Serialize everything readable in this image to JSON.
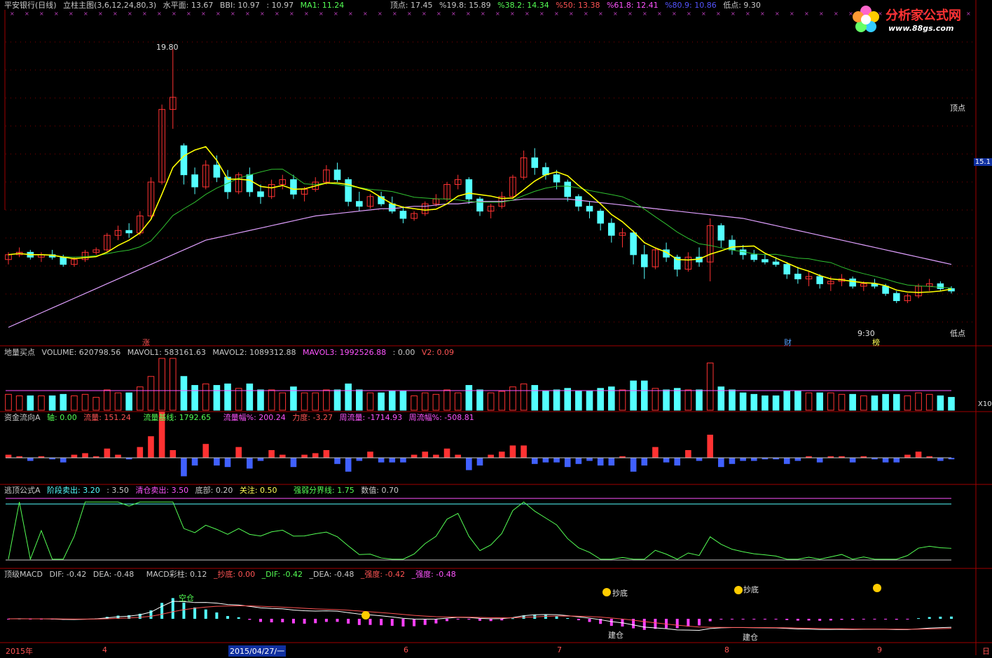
{
  "header": {
    "title": "平安银行(日线)",
    "indicator": "立柱主图(3,6,12,24,80,3)",
    "shuipingmian": "水平面: 13.67",
    "bbi": "BBI: 10.97",
    "extra": ": 10.97",
    "ma1": "MA1: 11.24",
    "top": "顶点: 17.45",
    "p19": "%19.8: 15.89",
    "p38": "%38.2: 14.34",
    "p50": "%50: 13.38",
    "p61": "%61.8: 12.41",
    "p80": "%80.9: 10.86",
    "low": "低点: 9.30"
  },
  "logo": {
    "title": "分析家公式网",
    "url": "www.88gs.com"
  },
  "main_annotations": {
    "high_label": "19.80",
    "low_label": "9:30",
    "top_right": "顶点",
    "bottom_right": "低点",
    "price_box": "15.1",
    "zhang": "涨",
    "cai": "财",
    "bang": "榜"
  },
  "volume_header": {
    "name": "地量买点",
    "volume": "VOLUME: 620798.56",
    "mavol1": "MAVOL1: 583161.63",
    "mavol2": "MAVOL2: 1089312.88",
    "mavol3": "MAVOL3: 1992526.88",
    "v1": ": 0.00",
    "v2": "V2: 0.09",
    "axis_unit": "X10"
  },
  "flow_header": {
    "name": "资金流向A",
    "axis": "轴: 0.00",
    "liuliang": "流量: 151.24",
    "jixian": "流量基线: 1792.65",
    "fu": "流量幅%: 200.24",
    "lidu": "力度: -3.27",
    "zhou": "周流量: -1714.93",
    "zhoufu": "周流幅%: -508.81"
  },
  "escape_header": {
    "name": "逃顶公式A",
    "jieduan": "阶段卖出: 3.20",
    "v350": ": 3.50",
    "qingcang": "清仓卖出: 3.50",
    "dibu": "底部: 0.20",
    "guanzhu": "关注: 0.50",
    "qiangruo": "强弱分界线: 1.75",
    "shuzhi": "数值: 0.70"
  },
  "macd_header": {
    "name": "顶级MACD",
    "dif": "DIF: -0.42",
    "dea": "DEA: -0.48",
    "bar": "MACD彩柱: 0.12",
    "chaodi": "_抄底: 0.00",
    "dif2": "_DIF: -0.42",
    "dea2": "_DEA: -0.48",
    "qiang": "_强度: -0.42",
    "ruo": "_强度: -0.48"
  },
  "macd_labels": {
    "chaodi": "抄底",
    "jiancang": "建仓",
    "jiancang2": "建仓",
    "chaodi2": "抄底",
    "kongcang": "空仓"
  },
  "date_axis": {
    "year": "2015年",
    "m4": "4",
    "sel": "2015/04/27/一",
    "m6": "6",
    "m7": "7",
    "m8": "8",
    "m9": "9",
    "end": "日"
  },
  "colors": {
    "up": "#ff3232",
    "down": "#54ffff",
    "yellow": "#ffff00",
    "blue": "#0000ff",
    "green": "#00ff00",
    "grid": "#880000"
  },
  "chart_data": {
    "type": "candlestick",
    "candles": [
      [
        11.1,
        11.4,
        10.9,
        11.3
      ],
      [
        11.3,
        11.6,
        11.2,
        11.4
      ],
      [
        11.4,
        11.5,
        11.1,
        11.2
      ],
      [
        11.2,
        11.4,
        11.0,
        11.3
      ],
      [
        11.3,
        11.5,
        11.1,
        11.2
      ],
      [
        11.2,
        11.3,
        10.8,
        10.9
      ],
      [
        10.9,
        11.2,
        10.8,
        11.1
      ],
      [
        11.1,
        11.5,
        11.0,
        11.4
      ],
      [
        11.4,
        11.6,
        11.3,
        11.5
      ],
      [
        11.5,
        12.2,
        11.4,
        12.1
      ],
      [
        12.1,
        12.5,
        11.9,
        12.3
      ],
      [
        12.3,
        12.6,
        12.0,
        12.2
      ],
      [
        12.2,
        13.1,
        12.1,
        12.9
      ],
      [
        12.9,
        14.5,
        12.8,
        14.3
      ],
      [
        14.3,
        17.5,
        14.2,
        17.3
      ],
      [
        17.3,
        19.8,
        16.5,
        17.8
      ],
      [
        15.8,
        15.9,
        14.2,
        14.6
      ],
      [
        14.6,
        14.9,
        13.8,
        14.1
      ],
      [
        14.1,
        15.2,
        14.0,
        15.0
      ],
      [
        15.0,
        15.4,
        14.3,
        14.5
      ],
      [
        14.5,
        14.8,
        13.6,
        13.9
      ],
      [
        13.9,
        14.7,
        13.8,
        14.6
      ],
      [
        14.6,
        14.9,
        13.7,
        13.9
      ],
      [
        13.9,
        14.2,
        13.4,
        13.7
      ],
      [
        13.7,
        14.4,
        13.6,
        14.2
      ],
      [
        14.2,
        14.6,
        14.0,
        14.4
      ],
      [
        14.4,
        14.6,
        13.6,
        13.8
      ],
      [
        13.8,
        14.1,
        13.5,
        14.0
      ],
      [
        14.0,
        14.5,
        13.9,
        14.3
      ],
      [
        14.3,
        15.0,
        14.2,
        14.8
      ],
      [
        14.8,
        15.1,
        14.3,
        14.4
      ],
      [
        14.4,
        14.5,
        13.3,
        13.5
      ],
      [
        13.5,
        13.9,
        13.1,
        13.3
      ],
      [
        13.3,
        13.8,
        13.2,
        13.7
      ],
      [
        13.7,
        13.9,
        13.3,
        13.4
      ],
      [
        13.4,
        13.7,
        13.0,
        13.1
      ],
      [
        13.1,
        13.3,
        12.6,
        12.8
      ],
      [
        12.8,
        13.1,
        12.7,
        13.0
      ],
      [
        13.0,
        13.5,
        12.9,
        13.4
      ],
      [
        13.4,
        13.8,
        13.3,
        13.6
      ],
      [
        13.6,
        14.3,
        13.5,
        14.2
      ],
      [
        14.2,
        14.6,
        14.0,
        14.4
      ],
      [
        14.4,
        14.5,
        13.4,
        13.6
      ],
      [
        13.6,
        13.7,
        12.9,
        13.1
      ],
      [
        13.1,
        13.4,
        12.8,
        13.3
      ],
      [
        13.3,
        13.9,
        13.2,
        13.7
      ],
      [
        13.7,
        14.6,
        13.6,
        14.5
      ],
      [
        14.5,
        15.6,
        14.4,
        15.3
      ],
      [
        15.3,
        15.7,
        14.6,
        14.9
      ],
      [
        14.9,
        15.1,
        14.4,
        14.6
      ],
      [
        14.6,
        14.8,
        14.0,
        14.3
      ],
      [
        14.3,
        14.4,
        13.5,
        13.7
      ],
      [
        13.7,
        13.8,
        13.1,
        13.3
      ],
      [
        13.3,
        13.5,
        12.8,
        13.1
      ],
      [
        13.1,
        13.2,
        12.3,
        12.6
      ],
      [
        12.6,
        12.8,
        11.8,
        12.1
      ],
      [
        12.1,
        12.4,
        11.6,
        12.2
      ],
      [
        12.2,
        12.3,
        10.9,
        11.3
      ],
      [
        11.3,
        11.7,
        10.3,
        10.8
      ],
      [
        10.8,
        11.6,
        10.7,
        11.5
      ],
      [
        11.5,
        11.8,
        11.0,
        11.2
      ],
      [
        11.2,
        11.3,
        10.4,
        10.7
      ],
      [
        10.7,
        11.4,
        10.6,
        11.2
      ],
      [
        11.2,
        11.6,
        10.8,
        11.0
      ],
      [
        11.0,
        12.8,
        10.2,
        12.5
      ],
      [
        12.5,
        12.6,
        11.6,
        11.9
      ],
      [
        11.9,
        12.1,
        11.3,
        11.5
      ],
      [
        11.5,
        11.7,
        11.1,
        11.3
      ],
      [
        11.3,
        11.5,
        11.0,
        11.1
      ],
      [
        11.1,
        11.3,
        10.9,
        11.0
      ],
      [
        11.0,
        11.2,
        10.8,
        10.9
      ],
      [
        10.9,
        11.0,
        10.3,
        10.5
      ],
      [
        10.5,
        10.8,
        10.1,
        10.3
      ],
      [
        10.3,
        10.6,
        10.0,
        10.4
      ],
      [
        10.4,
        10.5,
        9.9,
        10.1
      ],
      [
        10.1,
        10.4,
        9.8,
        10.2
      ],
      [
        10.2,
        10.5,
        10.0,
        10.3
      ],
      [
        10.3,
        10.4,
        9.9,
        10.0
      ],
      [
        10.0,
        10.2,
        9.8,
        10.1
      ],
      [
        10.1,
        10.3,
        9.9,
        10.0
      ],
      [
        10.0,
        10.1,
        9.6,
        9.7
      ],
      [
        9.7,
        9.8,
        9.3,
        9.4
      ],
      [
        9.4,
        9.7,
        9.3,
        9.6
      ],
      [
        9.6,
        10.1,
        9.5,
        10.0
      ],
      [
        10.0,
        10.3,
        9.8,
        10.1
      ],
      [
        10.1,
        10.2,
        9.8,
        9.9
      ],
      [
        9.9,
        10.0,
        9.7,
        9.8
      ]
    ],
    "ma_long": [
      8.3,
      8.5,
      8.7,
      8.9,
      9.1,
      9.3,
      9.5,
      9.7,
      9.9,
      10.1,
      10.3,
      10.5,
      10.7,
      10.9,
      11.1,
      11.3,
      11.5,
      11.7,
      11.9,
      12.0,
      12.1,
      12.2,
      12.3,
      12.4,
      12.5,
      12.6,
      12.7,
      12.8,
      12.9,
      12.95,
      13.0,
      13.05,
      13.1,
      13.15,
      13.2,
      13.2,
      13.25,
      13.3,
      13.3,
      13.35,
      13.4,
      13.4,
      13.45,
      13.5,
      13.5,
      13.5,
      13.55,
      13.6,
      13.6,
      13.6,
      13.6,
      13.6,
      13.55,
      13.5,
      13.45,
      13.4,
      13.35,
      13.3,
      13.25,
      13.2,
      13.15,
      13.1,
      13.05,
      13.0,
      12.95,
      12.9,
      12.85,
      12.8,
      12.7,
      12.6,
      12.5,
      12.4,
      12.3,
      12.2,
      12.1,
      12.0,
      11.9,
      11.8,
      11.7,
      11.6,
      11.5,
      11.4,
      11.3,
      11.2,
      11.1,
      11.0,
      10.9
    ]
  }
}
